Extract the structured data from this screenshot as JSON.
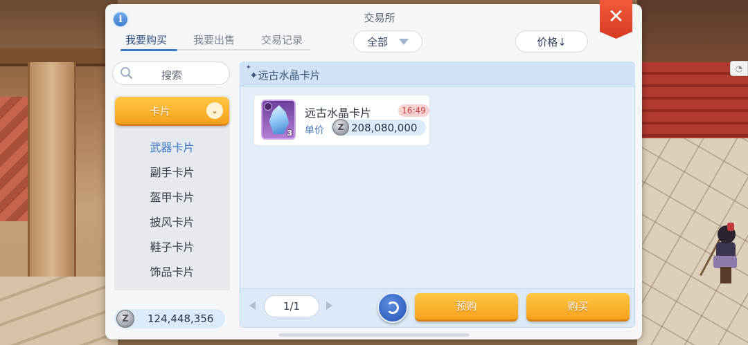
{
  "header": {
    "title": "交易所",
    "info_icon": "i",
    "close_icon": "✕"
  },
  "tabs": [
    {
      "label": "我要购买",
      "active": true
    },
    {
      "label": "我要出售",
      "active": false
    },
    {
      "label": "交易记录",
      "active": false
    }
  ],
  "filter": {
    "selected": "全部",
    "sort_label": "价格↓"
  },
  "search": {
    "label": "搜索"
  },
  "category": {
    "selected": "卡片",
    "subitems": [
      "武器卡片",
      "副手卡片",
      "盔甲卡片",
      "披风卡片",
      "鞋子卡片",
      "饰品卡片"
    ],
    "active_subitem": "武器卡片"
  },
  "wallet": {
    "coin_symbol": "Z",
    "zeny": "124,448,356"
  },
  "listing": {
    "heading": "远古水晶卡片",
    "items": [
      {
        "name": "远古水晶卡片",
        "time": "16:49",
        "price_label": "单价",
        "price": "208,080,000",
        "quantity": "3"
      }
    ]
  },
  "pagination": {
    "page": "1/1"
  },
  "actions": {
    "preorder": "预购",
    "buy": "购买"
  },
  "colors": {
    "accent_blue": "#3c78c8",
    "button_orange": "#f7a01c",
    "close_red": "#e24a2e"
  }
}
